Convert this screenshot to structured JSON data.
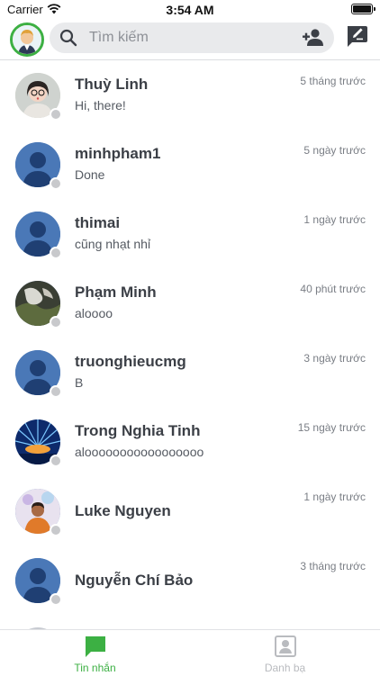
{
  "status_bar": {
    "carrier": "Carrier",
    "time": "3:54 AM"
  },
  "search": {
    "placeholder": "Tìm kiếm"
  },
  "conversations": [
    {
      "name": "Thuỳ Linh",
      "message": "Hi, there!",
      "time": "5 tháng trước",
      "avatar": "girl-photo"
    },
    {
      "name": "minhpham1",
      "message": "Done",
      "time": "5 ngày trước",
      "avatar": "default-person"
    },
    {
      "name": "thimai",
      "message": "cũng nhạt nhỉ",
      "time": "1 ngày trước",
      "avatar": "default-person"
    },
    {
      "name": "Phạm Minh",
      "message": "aloooo",
      "time": "40 phút trước",
      "avatar": "dark-photo"
    },
    {
      "name": "truonghieucmg",
      "message": "B",
      "time": "3 ngày trước",
      "avatar": "default-person"
    },
    {
      "name": "Trong Nghia Tinh",
      "message": "alooooooooooooooooo",
      "time": "15 ngày trước",
      "avatar": "blue-burst-photo"
    },
    {
      "name": "Luke Nguyen",
      "message": "",
      "time": "1 ngày trước",
      "avatar": "person-photo"
    },
    {
      "name": "Nguyễn Chí Bảo",
      "message": "",
      "time": "3 tháng trước",
      "avatar": "default-person"
    }
  ],
  "tabs": [
    {
      "label": "Tin nhắn",
      "icon": "chat-bubble-icon",
      "active": true
    },
    {
      "label": "Danh bạ",
      "icon": "contacts-icon",
      "active": false
    }
  ],
  "colors": {
    "accent": "#3cb043",
    "online_dot": "#c8c9cc",
    "avatar_default": "#4a78b7"
  }
}
